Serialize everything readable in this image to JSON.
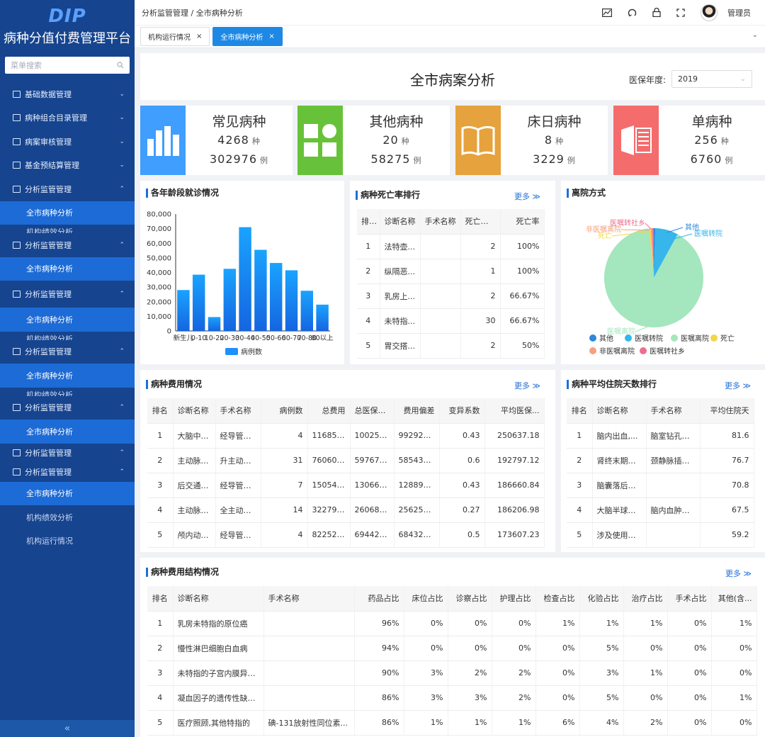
{
  "sidebar": {
    "logo": "DIP",
    "brand": "病种分值付费管理平台",
    "search_placeholder": "菜单搜索",
    "menu": [
      {
        "label": "基础数据管理"
      },
      {
        "label": "病种组合目录管理"
      },
      {
        "label": "病案审核管理"
      },
      {
        "label": "基金预结算管理"
      }
    ],
    "group_label": "分析监管管理",
    "sub_active": "全市病种分析",
    "sub_clipped": "机构绩效分析",
    "sub_performance": "机构绩效分析",
    "sub_running": "机构运行情况",
    "collapse": "«"
  },
  "topbar": {
    "breadcrumb": "分析监管管理 / 全市病种分析",
    "user": "管理员"
  },
  "tabs": [
    {
      "label": "机构运行情况",
      "close": "×"
    },
    {
      "label": "全市病种分析",
      "close": "×"
    }
  ],
  "header": {
    "title": "全市病案分析",
    "year_label": "医保年度:",
    "year_value": "2019"
  },
  "stats": [
    {
      "name": "常见病种",
      "kinds": "4268",
      "cases": "302976",
      "color": "#409eff"
    },
    {
      "name": "其他病种",
      "kinds": "20",
      "cases": "58275",
      "color": "#67c23a"
    },
    {
      "name": "床日病种",
      "kinds": "8",
      "cases": "3229",
      "color": "#e6a23c"
    },
    {
      "name": "单病种",
      "kinds": "256",
      "cases": "6760",
      "color": "#f56c6c"
    }
  ],
  "units": {
    "kind": "种",
    "case": "例"
  },
  "more": "更多 ≫",
  "age_chart": {
    "title": "各年龄段就诊情况",
    "legend": "病例数",
    "chart_data": {
      "type": "bar",
      "categories": [
        "新生儿",
        "0-10",
        "10-20",
        "20-30",
        "30-40",
        "40-50",
        "50-60",
        "60-70",
        "70-80",
        "80以上"
      ],
      "series": [
        {
          "name": "病例数",
          "values": [
            28000,
            38500,
            9500,
            42500,
            71000,
            55500,
            46500,
            41500,
            27500,
            18000
          ]
        }
      ],
      "ylim": [
        0,
        80000
      ],
      "yticks": [
        "80,000",
        "70,000",
        "60,000",
        "50,000",
        "40,000",
        "30,000",
        "20,000",
        "10,000",
        "0"
      ],
      "color": "#1e90ff"
    }
  },
  "mortality": {
    "title": "病种死亡率排行",
    "headers": [
      "排名",
      "诊断名称",
      "手术名称",
      "死亡病...",
      "死亡率"
    ],
    "rows": [
      [
        "1",
        "法特壶...",
        "",
        "2",
        "100%"
      ],
      [
        "2",
        "纵隔恶...",
        "",
        "1",
        "100%"
      ],
      [
        "3",
        "乳房上...",
        "",
        "2",
        "66.67%"
      ],
      [
        "4",
        "未特指...",
        "",
        "30",
        "66.67%"
      ],
      [
        "5",
        "胃交搭...",
        "",
        "2",
        "50%"
      ]
    ]
  },
  "discharge": {
    "title": "离院方式",
    "chart_data": {
      "type": "pie",
      "labels": [
        "其他",
        "医嘱转院",
        "医嘱离院",
        "死亡",
        "非医嘱离院",
        "医嘱转社乡"
      ],
      "values": [
        0.5,
        7.5,
        90.5,
        0.5,
        0.5,
        0.5
      ],
      "colors": [
        "#2f87d9",
        "#36b6ea",
        "#a4e6bd",
        "#f5d547",
        "#f5a07e",
        "#ef6d8f"
      ]
    },
    "callouts": {
      "qita": "其他",
      "zhuanyuan": "医嘱转院",
      "zhuanshe": "医嘱转社乡",
      "feiyizhu": "非医嘱离院",
      "siwang": "死亡",
      "liyuan": "医嘱离院"
    },
    "legend": [
      "其他",
      "医嘱转院",
      "医嘱离院",
      "死亡",
      "非医嘱离院",
      "医嘱转社乡"
    ]
  },
  "cost": {
    "title": "病种费用情况",
    "headers": [
      "排名",
      "诊断名称",
      "手术名称",
      "病例数",
      "总费用",
      "总医保费...",
      "费用偏差",
      "变异系数",
      "平均医保..."
    ],
    "rows": [
      [
        "1",
        "大脑中动...",
        "经导管颅...",
        "4",
        "1168523...",
        "1002548...",
        "992926....",
        "0.43",
        "250637.18"
      ],
      [
        "2",
        "主动脉夹...",
        "升主动脉...",
        "31",
        "7606096...",
        "5976710...",
        "5854352...",
        "0.6",
        "192797.12"
      ],
      [
        "3",
        "后交通动...",
        "经导管颅...",
        "7",
        "1505414...",
        "1306625...",
        "1288972...",
        "0.43",
        "186660.84"
      ],
      [
        "4",
        "主动脉夹...",
        "全主动脉...",
        "14",
        "3227997...",
        "2606897...",
        "2562587...",
        "0.27",
        "186206.98"
      ],
      [
        "5",
        "颅内动脉...",
        "经导管颅...",
        "4",
        "822521....",
        "694428.9",
        "684324....",
        "0.5",
        "173607.23"
      ]
    ]
  },
  "stay": {
    "title": "病种平均住院天数排行",
    "headers": [
      "排名",
      "诊断名称",
      "手术名称",
      "平均住院天"
    ],
    "rows": [
      [
        "1",
        "脑内出血,...",
        "脑室钻孔引...",
        "81.6"
      ],
      [
        "2",
        "肾终末期疾...",
        "颈静脉插管...",
        "76.7"
      ],
      [
        "3",
        "脑囊落后综...",
        "",
        "70.8"
      ],
      [
        "4",
        "大脑半球的...",
        "脑内血肿清...",
        "67.5"
      ],
      [
        "5",
        "涉及使用其...",
        "",
        "59.2"
      ]
    ]
  },
  "structure": {
    "title": "病种费用结构情况",
    "headers": [
      "排名",
      "诊断名称",
      "手术名称",
      "药品占比",
      "床位占比",
      "诊察占比",
      "护理占比",
      "检查占比",
      "化验占比",
      "治疗占比",
      "手术占比",
      "其他(含..."
    ],
    "rows": [
      [
        "1",
        "乳房未特指的原位癌",
        "",
        "96%",
        "0%",
        "0%",
        "0%",
        "1%",
        "1%",
        "1%",
        "0%",
        "1%"
      ],
      [
        "2",
        "慢性淋巴细胞白血病",
        "",
        "94%",
        "0%",
        "0%",
        "0%",
        "0%",
        "5%",
        "0%",
        "0%",
        "0%"
      ],
      [
        "3",
        "未特指的子宫内膜异位...",
        "",
        "90%",
        "3%",
        "2%",
        "2%",
        "0%",
        "3%",
        "1%",
        "0%",
        "0%"
      ],
      [
        "4",
        "凝血因子的遗传性缺乏...",
        "",
        "86%",
        "3%",
        "3%",
        "2%",
        "0%",
        "5%",
        "0%",
        "0%",
        "1%"
      ],
      [
        "5",
        "医疗照顾,其他特指的",
        "碘-131放射性同位素...",
        "86%",
        "1%",
        "1%",
        "1%",
        "6%",
        "4%",
        "2%",
        "0%",
        "0%"
      ]
    ]
  }
}
